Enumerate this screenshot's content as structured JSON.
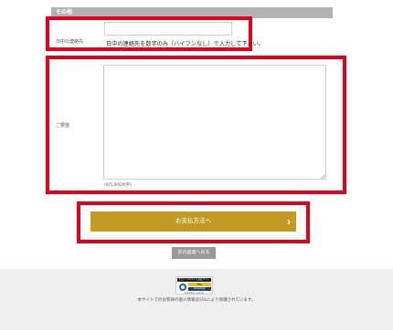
{
  "section": {
    "title": "その他"
  },
  "phone": {
    "label": "日中の連絡先",
    "value": "",
    "help": "日中の連絡先を数字のみ（ハイフンなし）で入力して下さい。"
  },
  "request": {
    "label": "ご要望",
    "value": "",
    "counter": "(0/5,000文字)"
  },
  "actions": {
    "pay_label": "お支払方法へ",
    "pay_chevron": "›",
    "back_label": "前の画面へ戻る"
  },
  "footer": {
    "seal_top": "グローバルサイン認証サイト",
    "seal_brand": "SSL",
    "seal_sub": "GlobalSign",
    "seal_bottom": "GlobalSign ≫ClickV",
    "text": "本サイトでのお客様の個人情報はSSLにより保護されています。"
  },
  "colors": {
    "highlight": "#e2001a",
    "pay_button": "#c39a22",
    "back_button": "#999999",
    "section_header": "#b3b3b3"
  }
}
